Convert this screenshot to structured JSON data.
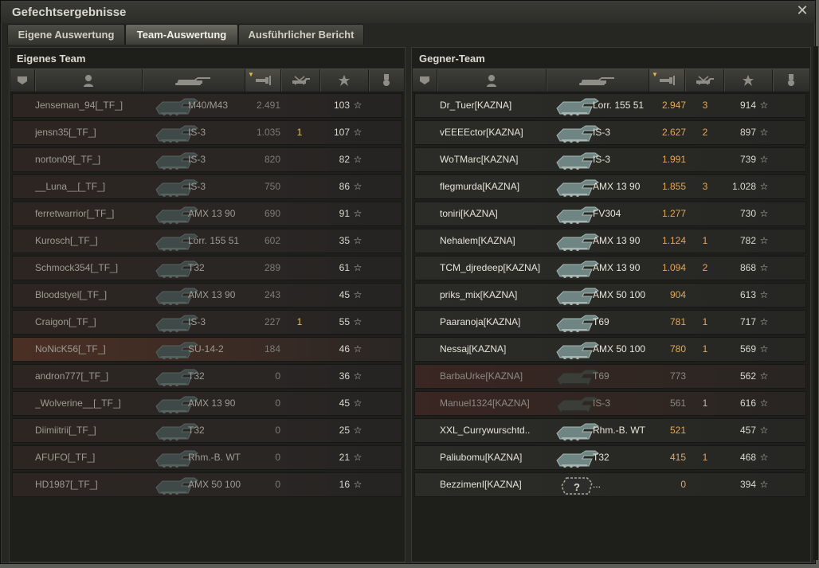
{
  "window": {
    "title": "Gefechtsergebnisse",
    "close_icon": "close-icon"
  },
  "tabs": [
    {
      "label": "Eigene Auswertung",
      "active": false
    },
    {
      "label": "Team-Auswertung",
      "active": true
    },
    {
      "label": "Ausführlicher Bericht",
      "active": false
    }
  ],
  "own_team": {
    "title": "Eigenes Team",
    "header_icons": [
      "rank-icon",
      "player-icon",
      "tank-icon",
      "damage-icon",
      "kills-icon",
      "xp-star-icon",
      "medal-icon"
    ],
    "players": [
      {
        "name": "Jenseman_94[_TF_]",
        "tank": "M40/M43",
        "damage": "2.491",
        "kills": "",
        "xp": "103",
        "status": "normal"
      },
      {
        "name": "jensn35[_TF_]",
        "tank": "IS-3",
        "damage": "1.035",
        "kills": "1",
        "xp": "107",
        "status": "normal"
      },
      {
        "name": "norton09[_TF_]",
        "tank": "IS-3",
        "damage": "820",
        "kills": "",
        "xp": "82",
        "status": "normal"
      },
      {
        "name": "__Luna__[_TF_]",
        "tank": "IS-3",
        "damage": "750",
        "kills": "",
        "xp": "86",
        "status": "normal"
      },
      {
        "name": "ferretwarrior[_TF_]",
        "tank": "AMX 13 90",
        "damage": "690",
        "kills": "",
        "xp": "91",
        "status": "normal"
      },
      {
        "name": "Kurosch[_TF_]",
        "tank": "Lorr. 155 51",
        "damage": "602",
        "kills": "",
        "xp": "35",
        "status": "normal"
      },
      {
        "name": "Schmock354[_TF_]",
        "tank": "T32",
        "damage": "289",
        "kills": "",
        "xp": "61",
        "status": "normal"
      },
      {
        "name": "Bloodstyel[_TF_]",
        "tank": "AMX 13 90",
        "damage": "243",
        "kills": "",
        "xp": "45",
        "status": "normal"
      },
      {
        "name": "Craigon[_TF_]",
        "tank": "IS-3",
        "damage": "227",
        "kills": "1",
        "xp": "55",
        "status": "normal"
      },
      {
        "name": "NoNicK56[_TF_]",
        "tank": "SU-14-2",
        "damage": "184",
        "kills": "",
        "xp": "46",
        "status": "self"
      },
      {
        "name": "andron777[_TF_]",
        "tank": "T32",
        "damage": "0",
        "kills": "",
        "xp": "36",
        "status": "normal"
      },
      {
        "name": "_Wolverine__[_TF_]",
        "tank": "AMX 13 90",
        "damage": "0",
        "kills": "",
        "xp": "45",
        "status": "normal"
      },
      {
        "name": "Diimiitrii[_TF_]",
        "tank": "T32",
        "damage": "0",
        "kills": "",
        "xp": "25",
        "status": "normal"
      },
      {
        "name": "AFUFO[_TF_]",
        "tank": "Rhm.-B. WT",
        "damage": "0",
        "kills": "",
        "xp": "21",
        "status": "normal"
      },
      {
        "name": "HD1987[_TF_]",
        "tank": "AMX 50 100",
        "damage": "0",
        "kills": "",
        "xp": "16",
        "status": "normal"
      }
    ]
  },
  "enemy_team": {
    "title": "Gegner-Team",
    "header_icons": [
      "rank-icon",
      "player-icon",
      "tank-icon",
      "damage-icon",
      "kills-icon",
      "xp-star-icon",
      "medal-icon"
    ],
    "players": [
      {
        "name": "Dr_Tuer[KAZNA]",
        "tank": "Lorr. 155 51",
        "damage": "2.947",
        "kills": "3",
        "xp": "914",
        "status": "alive"
      },
      {
        "name": "vEEEEctor[KAZNA]",
        "tank": "IS-3",
        "damage": "2.627",
        "kills": "2",
        "xp": "897",
        "status": "alive"
      },
      {
        "name": "WoTMarc[KAZNA]",
        "tank": "IS-3",
        "damage": "1.991",
        "kills": "",
        "xp": "739",
        "status": "alive"
      },
      {
        "name": "flegmurda[KAZNA]",
        "tank": "AMX 13 90",
        "damage": "1.855",
        "kills": "3",
        "xp": "1.028",
        "status": "alive"
      },
      {
        "name": "toniri[KAZNA]",
        "tank": "FV304",
        "damage": "1.277",
        "kills": "",
        "xp": "730",
        "status": "alive"
      },
      {
        "name": "Nehalem[KAZNA]",
        "tank": "AMX 13 90",
        "damage": "1.124",
        "kills": "1",
        "xp": "782",
        "status": "alive"
      },
      {
        "name": "TCM_djredeep[KAZNA]",
        "tank": "AMX 13 90",
        "damage": "1.094",
        "kills": "2",
        "xp": "868",
        "status": "alive"
      },
      {
        "name": "priks_mix[KAZNA]",
        "tank": "AMX 50 100",
        "damage": "904",
        "kills": "",
        "xp": "613",
        "status": "alive"
      },
      {
        "name": "Paaranoja[KAZNA]",
        "tank": "T69",
        "damage": "781",
        "kills": "1",
        "xp": "717",
        "status": "alive"
      },
      {
        "name": "Nessaj[KAZNA]",
        "tank": "AMX 50 100",
        "damage": "780",
        "kills": "1",
        "xp": "569",
        "status": "alive"
      },
      {
        "name": "BarbaUrke[KAZNA]",
        "tank": "T69",
        "damage": "773",
        "kills": "",
        "xp": "562",
        "status": "dead"
      },
      {
        "name": "Manuel1324[KAZNA]",
        "tank": "IS-3",
        "damage": "561",
        "kills": "1",
        "xp": "616",
        "status": "dead"
      },
      {
        "name": "XXL_Currywurschtd..",
        "tank": "Rhm.-B. WT",
        "damage": "521",
        "kills": "",
        "xp": "457",
        "status": "alive"
      },
      {
        "name": "Paliubomu[KAZNA]",
        "tank": "T32",
        "damage": "415",
        "kills": "1",
        "xp": "468",
        "status": "alive"
      },
      {
        "name": "BezzimenI[KAZNA]",
        "tank": "...",
        "damage": "0",
        "kills": "",
        "xp": "394",
        "status": "alive"
      }
    ]
  },
  "colors": {
    "enemy_damage": "#e3a85a",
    "own_kills": "#e2c16a",
    "self_row": "#4a2f24",
    "dead_row": "#3a2623"
  }
}
